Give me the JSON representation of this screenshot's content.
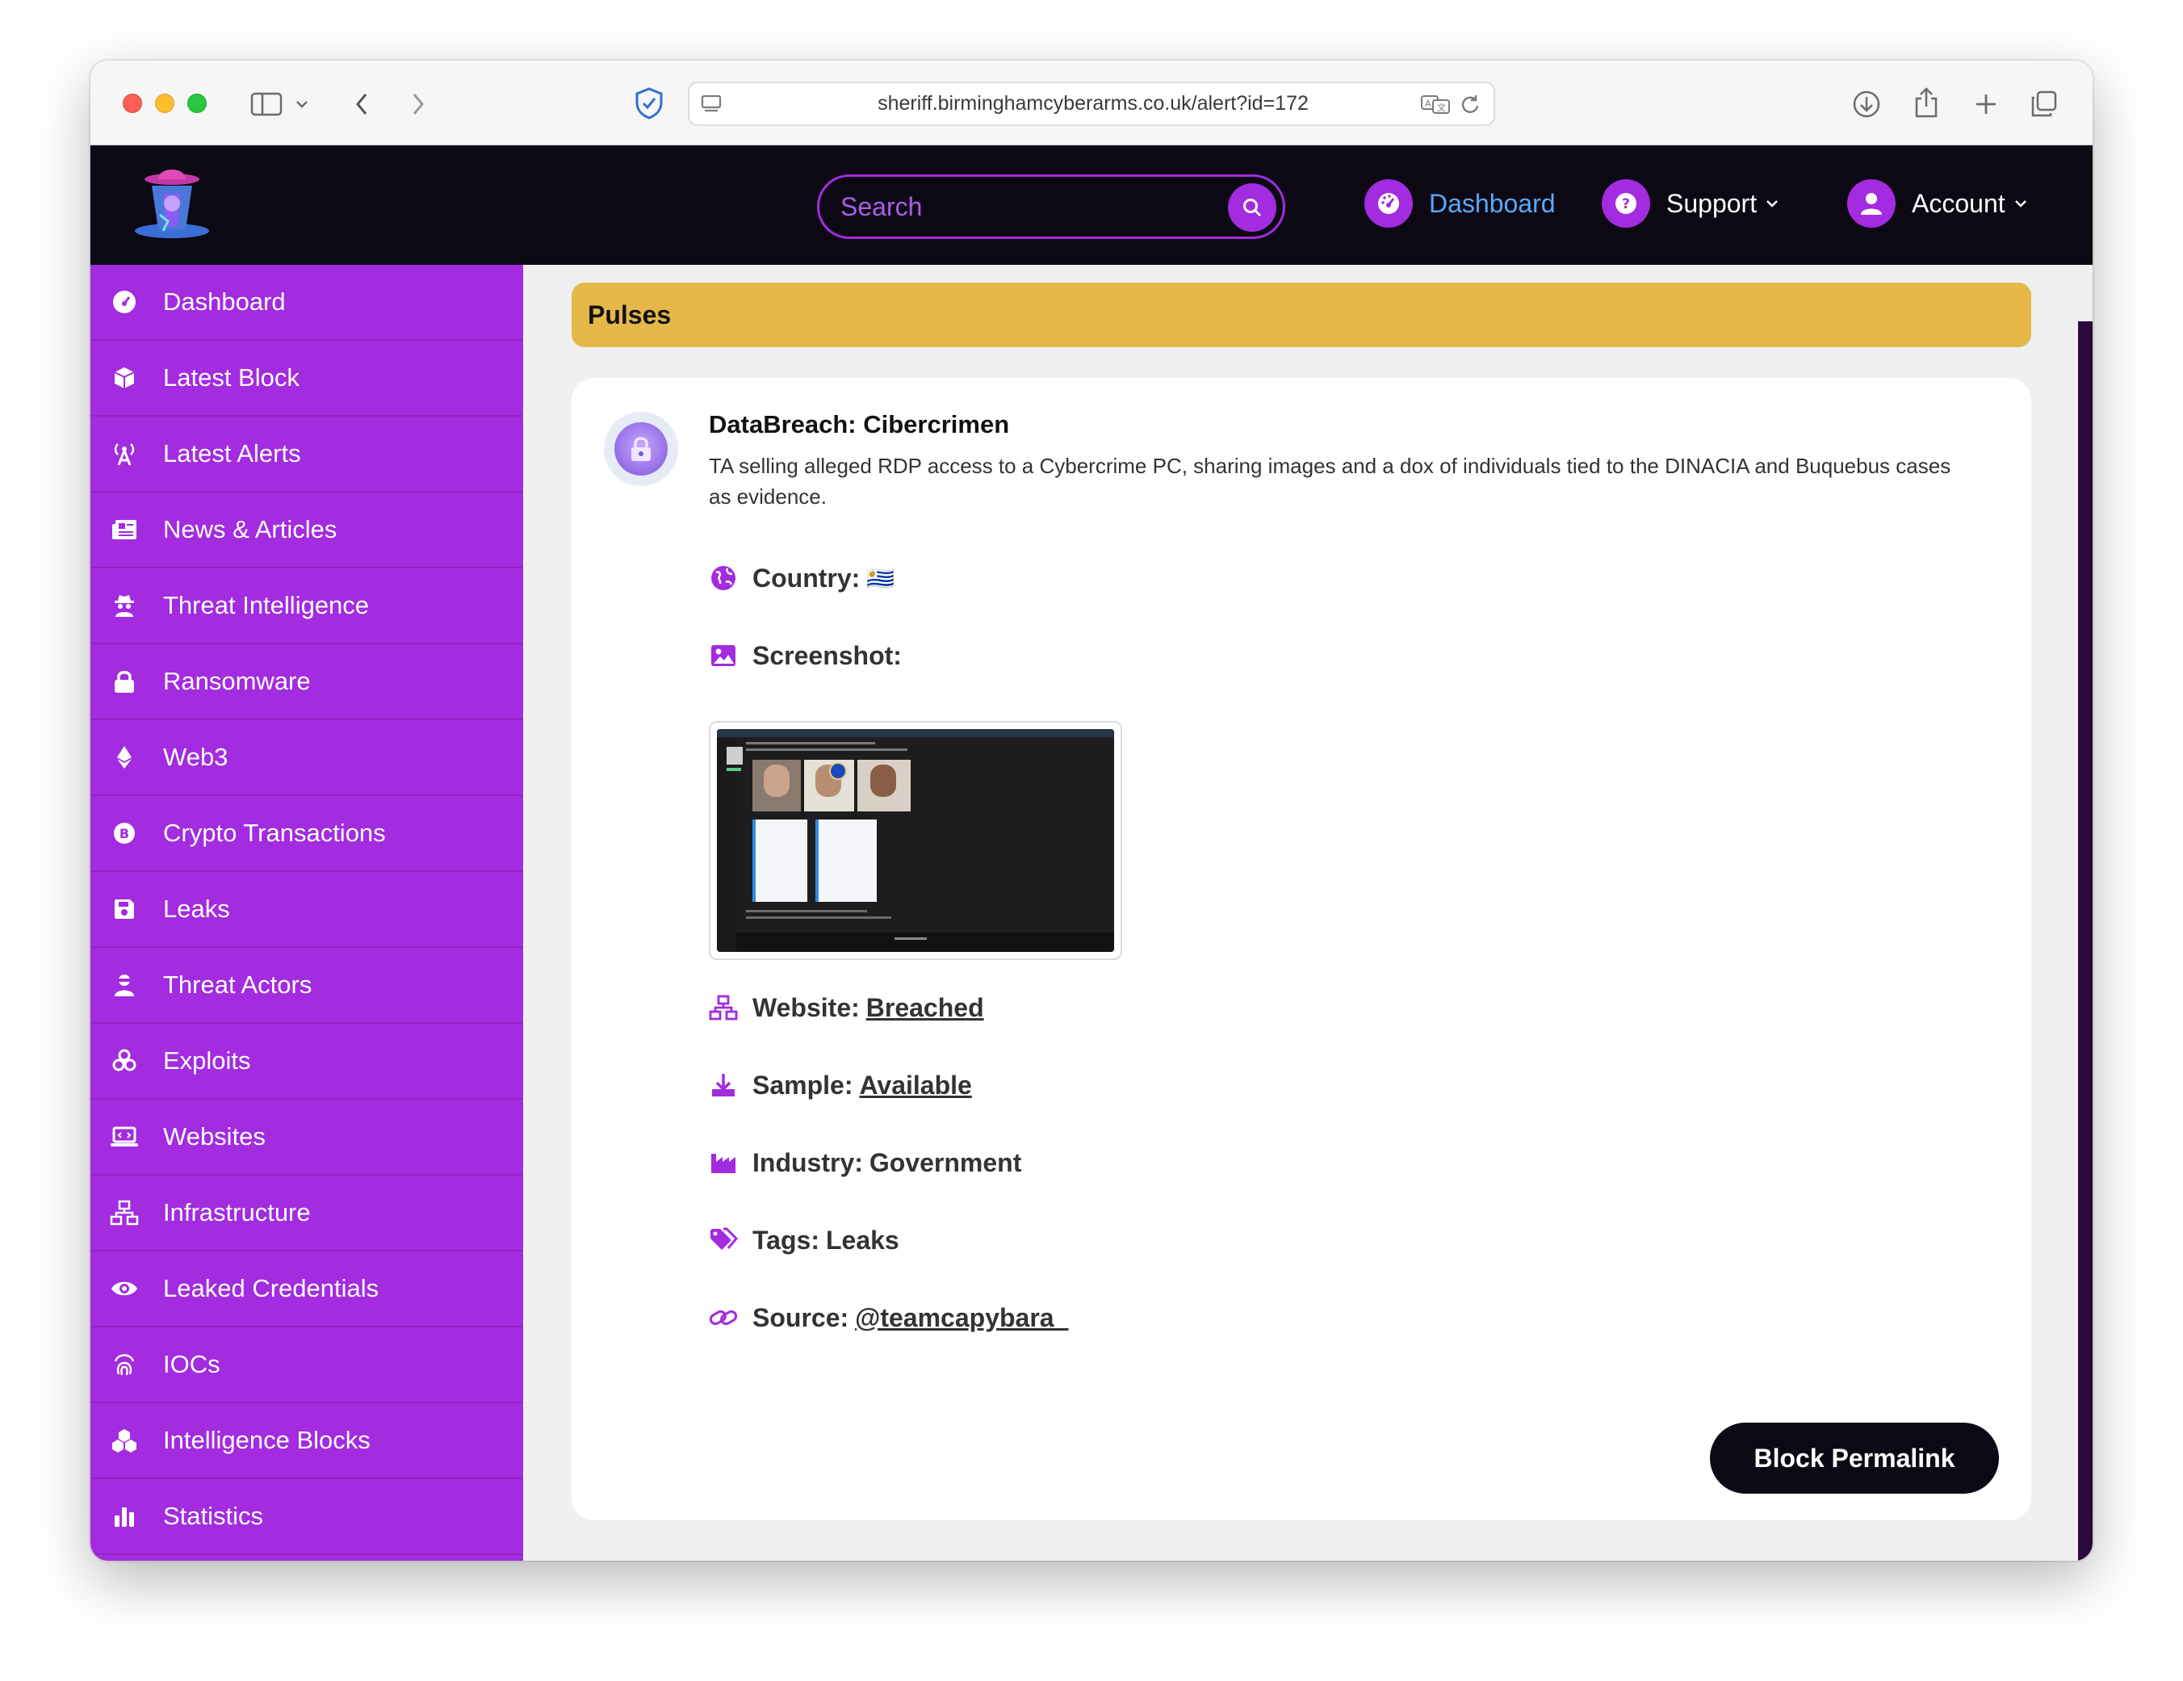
{
  "browser": {
    "url": "sheriff.birminghamcyberarms.co.uk/alert?id=172"
  },
  "header": {
    "search_placeholder": "Search",
    "nav": {
      "dashboard": "Dashboard",
      "support": "Support",
      "account": "Account"
    }
  },
  "sidebar": {
    "items": [
      {
        "label": "Dashboard",
        "icon": "gauge-icon"
      },
      {
        "label": "Latest Block",
        "icon": "cube-icon"
      },
      {
        "label": "Latest Alerts",
        "icon": "broadcast-tower-icon"
      },
      {
        "label": "News & Articles",
        "icon": "newspaper-icon"
      },
      {
        "label": "Threat Intelligence",
        "icon": "spy-icon"
      },
      {
        "label": "Ransomware",
        "icon": "lock-icon"
      },
      {
        "label": "Web3",
        "icon": "ethereum-icon"
      },
      {
        "label": "Crypto Transactions",
        "icon": "bitcoin-icon"
      },
      {
        "label": "Leaks",
        "icon": "floppy-disk-icon"
      },
      {
        "label": "Threat Actors",
        "icon": "user-ninja-icon"
      },
      {
        "label": "Exploits",
        "icon": "biohazard-icon"
      },
      {
        "label": "Websites",
        "icon": "laptop-code-icon"
      },
      {
        "label": "Infrastructure",
        "icon": "network-icon"
      },
      {
        "label": "Leaked Credentials",
        "icon": "eye-icon"
      },
      {
        "label": "IOCs",
        "icon": "fingerprint-icon"
      },
      {
        "label": "Intelligence Blocks",
        "icon": "cubes-icon"
      },
      {
        "label": "Statistics",
        "icon": "bar-chart-icon"
      }
    ]
  },
  "main": {
    "section_title": "Pulses",
    "alert": {
      "title": "DataBreach: Cibercrimen",
      "description": "TA selling alleged RDP access to a Cybercrime PC, sharing images and a dox of individuals tied to the DINACIA and Buquebus cases as evidence.",
      "country_label": "Country:",
      "country_flag": "🇺🇾",
      "screenshot_label": "Screenshot:",
      "website_label": "Website:",
      "website_value": "Breached",
      "sample_label": "Sample:",
      "sample_value": "Available",
      "industry_label": "Industry:",
      "industry_value": "Government",
      "tags_label": "Tags:",
      "tags_value": "Leaks",
      "source_label": "Source:",
      "source_value": "@teamcapybara_"
    },
    "permalink_label": "Block Permalink"
  },
  "colors": {
    "accent": "#a32be0",
    "header_bg": "#0d0914",
    "pulses_bar": "#e6b84a",
    "active_nav": "#59a9ff"
  }
}
